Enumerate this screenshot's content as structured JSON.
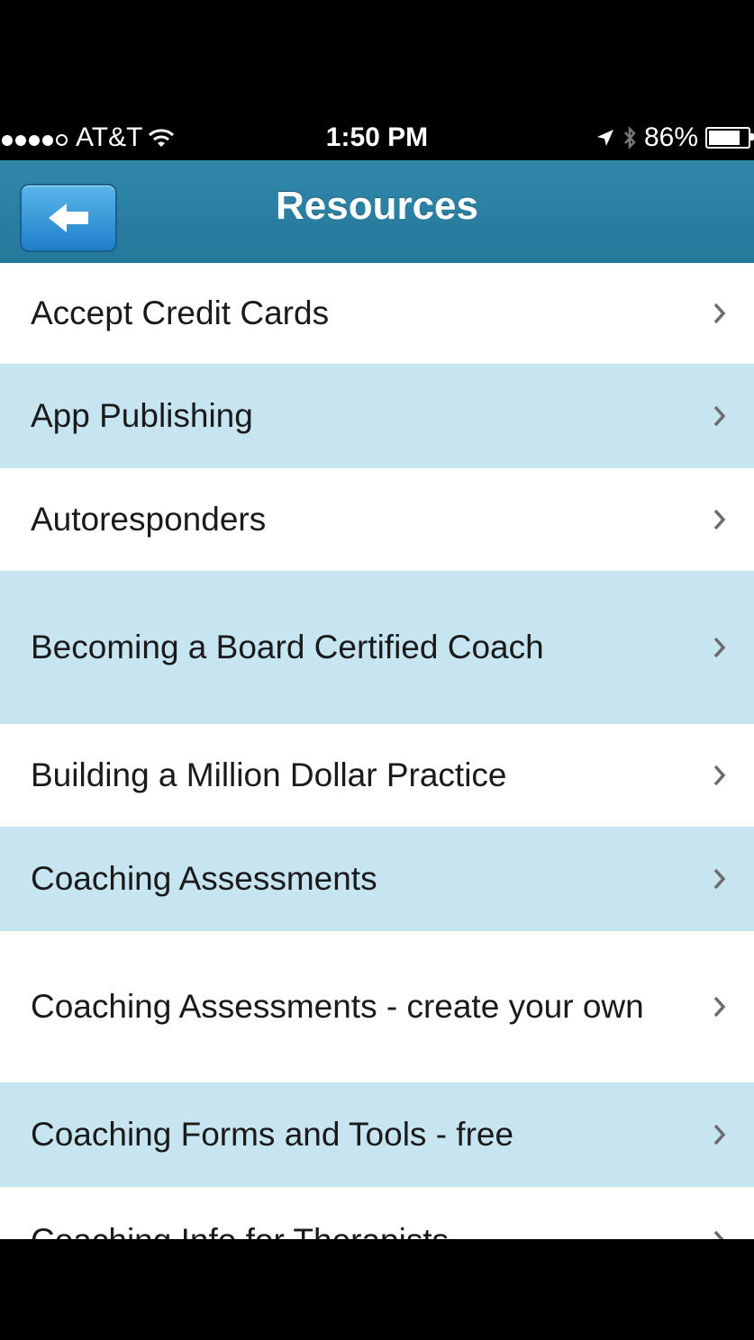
{
  "status_bar": {
    "carrier": "AT&T",
    "time": "1:50 PM",
    "battery": "86%",
    "battery_level": 0.86,
    "signal_bars": 4,
    "signal_max": 5
  },
  "nav": {
    "title": "Resources",
    "back_icon": "back-arrow-icon"
  },
  "list": {
    "items": [
      {
        "label": "Accept Credit Cards"
      },
      {
        "label": "App Publishing"
      },
      {
        "label": "Autoresponders"
      },
      {
        "label": "Becoming a Board Certified Coach"
      },
      {
        "label": "Building a Million Dollar Practice"
      },
      {
        "label": "Coaching Assessments"
      },
      {
        "label": "Coaching Assessments - create your own"
      },
      {
        "label": "Coaching Forms and Tools - free"
      },
      {
        "label": "Coaching Info for Therapists"
      }
    ],
    "row_color": "#ffffff",
    "alt_row_color": "#c6e5f1",
    "chevron_icon": "chevron-right-icon"
  },
  "colors": {
    "nav_bar": "#2a7fa0",
    "back_button": "#3a9ad9"
  }
}
